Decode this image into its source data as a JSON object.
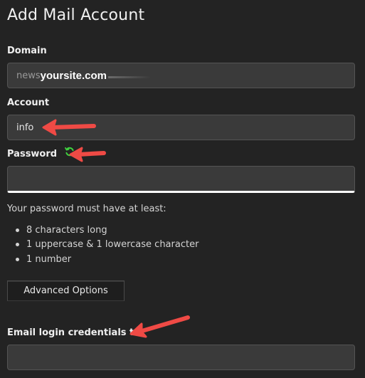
{
  "page": {
    "title": "Add Mail Account"
  },
  "domain": {
    "label": "Domain",
    "value_prefix": "news",
    "value_domain": "yoursite.com"
  },
  "account": {
    "label": "Account",
    "value": "info"
  },
  "password": {
    "label": "Password",
    "value": "",
    "hint": "Your password must have at least:",
    "rules": [
      "8 characters long",
      "1 uppercase & 1 lowercase character",
      "1 number"
    ]
  },
  "advanced": {
    "button_label": "Advanced Options"
  },
  "email_credentials": {
    "label": "Email login credentials to:",
    "value": ""
  },
  "icons": {
    "refresh": "refresh-icon",
    "annotation_arrow": "red-arrow-icon"
  },
  "colors": {
    "background": "#232323",
    "field_bg": "#3a3a3a",
    "refresh_icon": "#3fd13f",
    "annotation_arrow": "#ef4a45"
  }
}
